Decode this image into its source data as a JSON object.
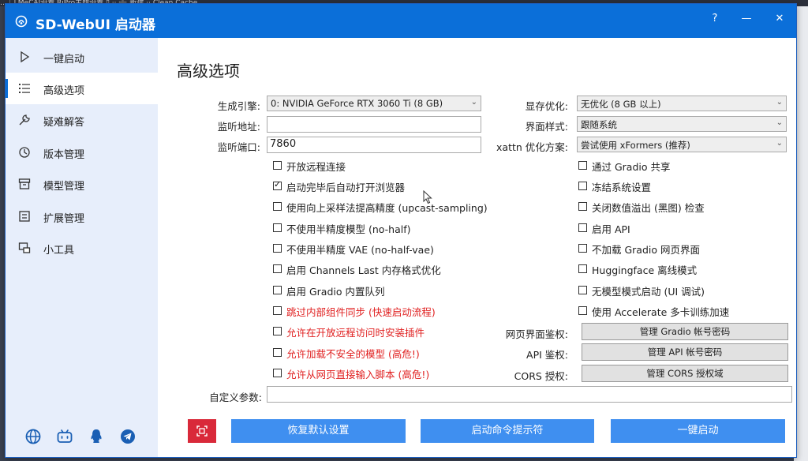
{
  "background": {
    "top_strip_text": "…  ❏  MeCAI设置  RiPro主题设置  ▯ ··  ➕ 新建  ·· Clean Cache"
  },
  "window": {
    "title": "SD-WebUI 启动器",
    "help_label": "?",
    "minimize_label": "—",
    "close_label": "✕"
  },
  "sidebar": {
    "items": [
      {
        "label": "一键启动",
        "icon": "play-icon",
        "active": false
      },
      {
        "label": "高级选项",
        "icon": "list-icon",
        "active": true
      },
      {
        "label": "疑难解答",
        "icon": "wrench-icon",
        "active": false
      },
      {
        "label": "版本管理",
        "icon": "history-icon",
        "active": false
      },
      {
        "label": "模型管理",
        "icon": "archive-icon",
        "active": false
      },
      {
        "label": "扩展管理",
        "icon": "extension-icon",
        "active": false
      },
      {
        "label": "小工具",
        "icon": "tools-icon",
        "active": false
      }
    ],
    "social_icons": [
      "globe-icon",
      "bilibili-icon",
      "qq-icon",
      "telegram-icon"
    ]
  },
  "page": {
    "title": "高级选项"
  },
  "form": {
    "engine_label": "生成引擎:",
    "engine_value": "0: NVIDIA GeForce RTX 3060 Ti (8 GB)",
    "listen_addr_label": "监听地址:",
    "listen_addr_value": "",
    "listen_port_label": "监听端口:",
    "listen_port_value": "7860",
    "vram_label": "显存优化:",
    "vram_value": "无优化 (8 GB 以上)",
    "theme_label": "界面样式:",
    "theme_value": "跟随系统",
    "xattn_label": "xattn 优化方案:",
    "xattn_value": "尝试使用 xFormers (推荐)",
    "webui_auth_label": "网页界面鉴权:",
    "webui_auth_button": "管理 Gradio 帐号密码",
    "api_auth_label": "API 鉴权:",
    "api_auth_button": "管理 API 帐号密码",
    "cors_label": "CORS 授权:",
    "cors_button": "管理 CORS 授权域",
    "custom_args_label": "自定义参数:",
    "custom_args_value": ""
  },
  "checkboxes_left": [
    {
      "label": "开放远程连接",
      "checked": false,
      "warning": false
    },
    {
      "label": "启动完毕后自动打开浏览器",
      "checked": true,
      "warning": false
    },
    {
      "label": "使用向上采样法提高精度 (upcast-sampling)",
      "checked": false,
      "warning": false
    },
    {
      "label": "不使用半精度模型 (no-half)",
      "checked": false,
      "warning": false
    },
    {
      "label": "不使用半精度 VAE (no-half-vae)",
      "checked": false,
      "warning": false
    },
    {
      "label": "启用 Channels Last 内存格式优化",
      "checked": false,
      "warning": false
    },
    {
      "label": "启用 Gradio 内置队列",
      "checked": false,
      "warning": false
    },
    {
      "label": "跳过内部组件同步 (快速启动流程)",
      "checked": false,
      "warning": true
    },
    {
      "label": "允许在开放远程访问时安装插件",
      "checked": false,
      "warning": true
    },
    {
      "label": "允许加载不安全的模型 (高危!)",
      "checked": false,
      "warning": true
    },
    {
      "label": "允许从网页直接输入脚本 (高危!)",
      "checked": false,
      "warning": true
    }
  ],
  "checkboxes_right": [
    {
      "label": "通过 Gradio 共享",
      "checked": false
    },
    {
      "label": "冻结系统设置",
      "checked": false
    },
    {
      "label": "关闭数值溢出 (黑图) 检查",
      "checked": false
    },
    {
      "label": "启用 API",
      "checked": false
    },
    {
      "label": "不加载 Gradio 网页界面",
      "checked": false
    },
    {
      "label": "Huggingface 离线模式",
      "checked": false
    },
    {
      "label": "无模型模式启动 (UI 调试)",
      "checked": false
    },
    {
      "label": "使用 Accelerate 多卡训练加速",
      "checked": false
    }
  ],
  "footer": {
    "reset_button": "恢复默认设置",
    "cmd_button": "启动命令提示符",
    "launch_button": "一键启动",
    "screenshot_icon": "screenshot-icon"
  },
  "colors": {
    "accent": "#0b6fd9",
    "sidebar_bg": "#e7eefb",
    "button_blue": "#3f8ff0",
    "danger": "#d9293a",
    "warning_text": "#e02020"
  }
}
